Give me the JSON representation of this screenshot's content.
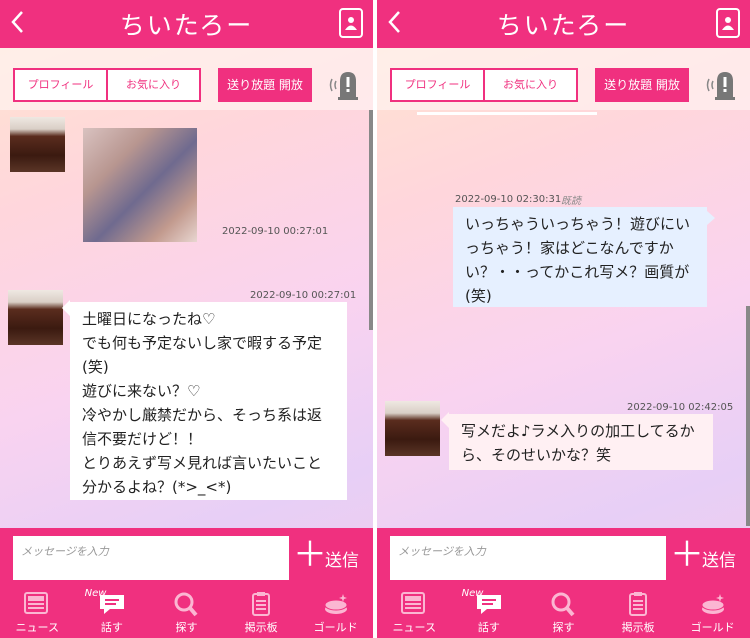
{
  "screens": [
    {
      "header": {
        "title": "ちいたろー"
      },
      "tabs": {
        "profile": "プロフィール",
        "favorite": "お気に入り"
      },
      "unlimited_label": "送り放題 開放",
      "messages": [
        {
          "timestamp": "2022-09-10 00:27:01"
        },
        {
          "timestamp": "2022-09-10 00:27:01",
          "text": "土曜日になったね♡\nでも何も予定ないし家で暇する予定(笑)\n遊びに来ない？♡\n冷やかし厳禁だから、そっち系は返信不要だけど！！\nとりあえず写メ見れば言いたいこと分かるよね？(*>_<*)"
        }
      ],
      "input": {
        "placeholder": "メッセージを入力"
      },
      "send_label": "送信",
      "nav": [
        {
          "label": "ニュース",
          "icon": "news-icon"
        },
        {
          "label": "話す",
          "icon": "chat-icon",
          "badge": "New"
        },
        {
          "label": "探す",
          "icon": "search-icon"
        },
        {
          "label": "掲示板",
          "icon": "board-icon"
        },
        {
          "label": "ゴールド",
          "icon": "gold-icon"
        }
      ]
    },
    {
      "header": {
        "title": "ちいたろー"
      },
      "tabs": {
        "profile": "プロフィール",
        "favorite": "お気に入り"
      },
      "unlimited_label": "送り放題 開放",
      "messages": [
        {
          "timestamp": "2022-09-10 02:30:31",
          "read": "既読",
          "text": "いっちゃういっちゃう！遊びにいっちゃう！家はどこなんですかい？・・ってかこれ写メ？画質が(笑)"
        },
        {
          "timestamp": "2022-09-10 02:42:05",
          "text": "写メだよ♪ラメ入りの加工してるから、そのせいかな？笑"
        }
      ],
      "input": {
        "placeholder": "メッセージを入力"
      },
      "send_label": "送信",
      "nav": [
        {
          "label": "ニュース",
          "icon": "news-icon"
        },
        {
          "label": "話す",
          "icon": "chat-icon",
          "badge": "New"
        },
        {
          "label": "探す",
          "icon": "search-icon"
        },
        {
          "label": "掲示板",
          "icon": "board-icon"
        },
        {
          "label": "ゴールド",
          "icon": "gold-icon"
        }
      ]
    }
  ],
  "colors": {
    "accent": "#f0307f",
    "bubble_sent": "#e6f0ff",
    "bubble_received": "#ffffff"
  }
}
